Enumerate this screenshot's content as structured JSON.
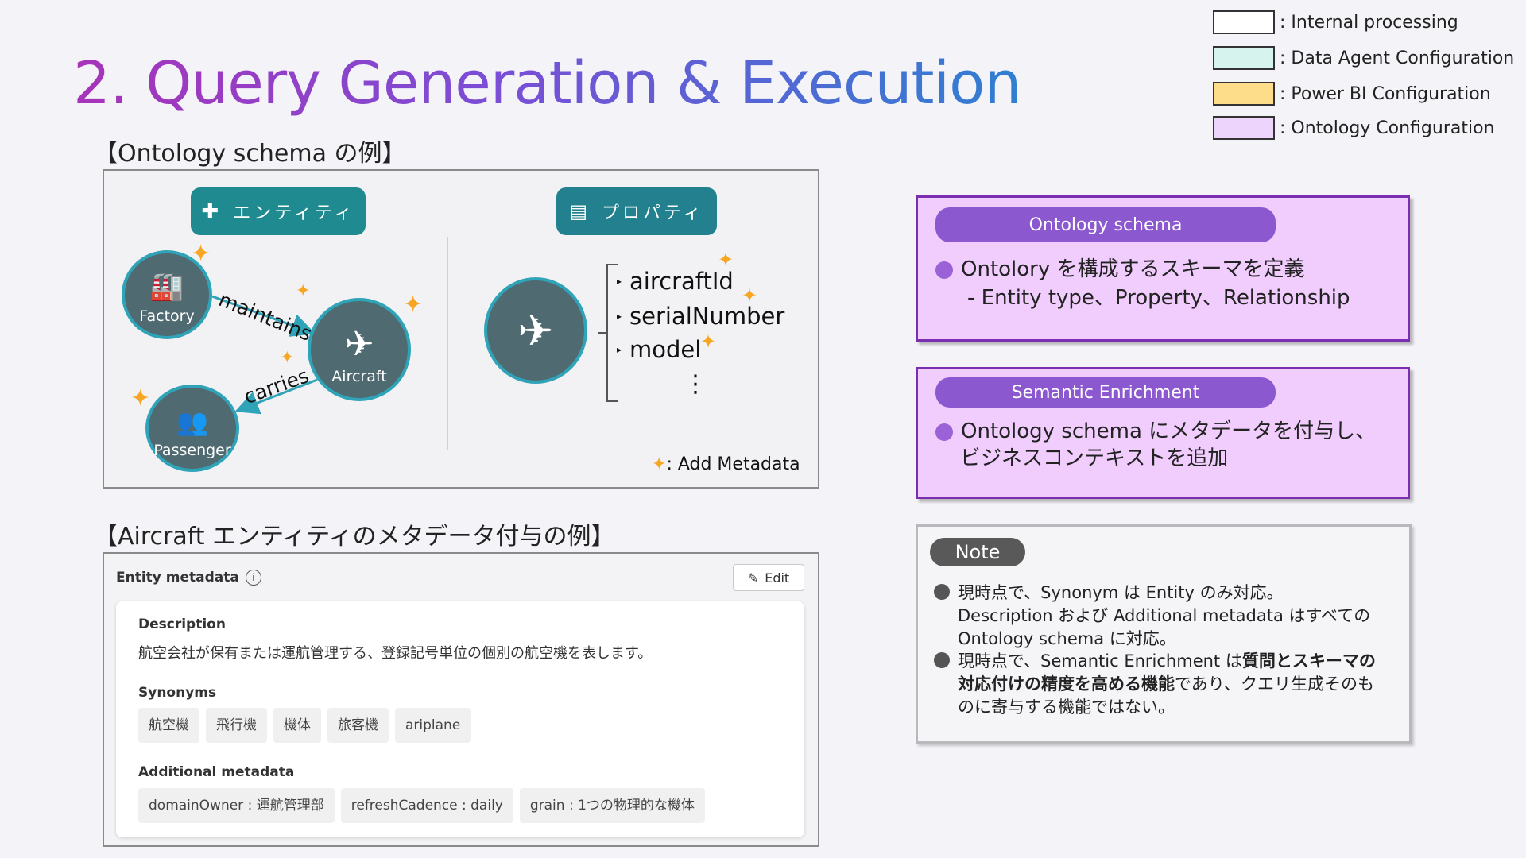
{
  "title": "2. Query Generation & Execution",
  "legend": [
    {
      "label": ": Internal processing",
      "color": "#ffffff"
    },
    {
      "label": ": Data Agent Configuration",
      "color": "#d7f3ee"
    },
    {
      "label": ": Power BI Configuration",
      "color": "#fddc8a"
    },
    {
      "label": ": Ontology Configuration",
      "color": "#ecd4fc"
    }
  ],
  "ontology_section": {
    "heading": "【Ontology schema の例】",
    "entity_button": "エンティティ",
    "property_button": "プロパティ",
    "nodes": {
      "factory": "Factory",
      "aircraft": "Aircraft",
      "passenger": "Passenger"
    },
    "edges": {
      "maintains": "maintains",
      "carries": "carries"
    },
    "properties": [
      "aircraftId",
      "serialNumber",
      "model"
    ],
    "more": "⋮",
    "add_metadata": ": Add Metadata"
  },
  "metadata_section": {
    "heading": "【Aircraft エンティティのメタデータ付与の例】",
    "panel_title": "Entity metadata",
    "edit_label": "Edit",
    "description_label": "Description",
    "description_text": "航空会社が保有または運航管理する、登録記号単位の個別の航空機を表します。",
    "synonyms_label": "Synonyms",
    "synonyms": [
      "航空機",
      "飛行機",
      "機体",
      "旅客機",
      "ariplane"
    ],
    "additional_label": "Additional metadata",
    "additional": [
      "domainOwner : 運航管理部",
      "refreshCadence : daily",
      "grain : 1つの物理的な機体"
    ]
  },
  "ontology_box": {
    "pill": "Ontology schema",
    "line1": "Ontolory を構成するスキーマを定義",
    "line2": "- Entity type、Property、Relationship"
  },
  "semantic_box": {
    "pill": "Semantic Enrichment",
    "line1": "Ontology schema にメタデータを付与し、",
    "line2": "ビジネスコンテキストを追加"
  },
  "note": {
    "pill": "Note",
    "b1_line1": "現時点で、Synonym は Entity のみ対応。",
    "b1_line2": "Description および Additional metadata はすべての",
    "b1_line3": "Ontology schema に対応。",
    "b2_line1_a": "現時点で、Semantic Enrichment は",
    "b2_line1_b": "質問とスキーマの",
    "b2_line2_a": "対応付けの精度を高める機能",
    "b2_line2_b": "であり、クエリ生成そのも",
    "b2_line3": "のに寄与する機能ではない。"
  }
}
